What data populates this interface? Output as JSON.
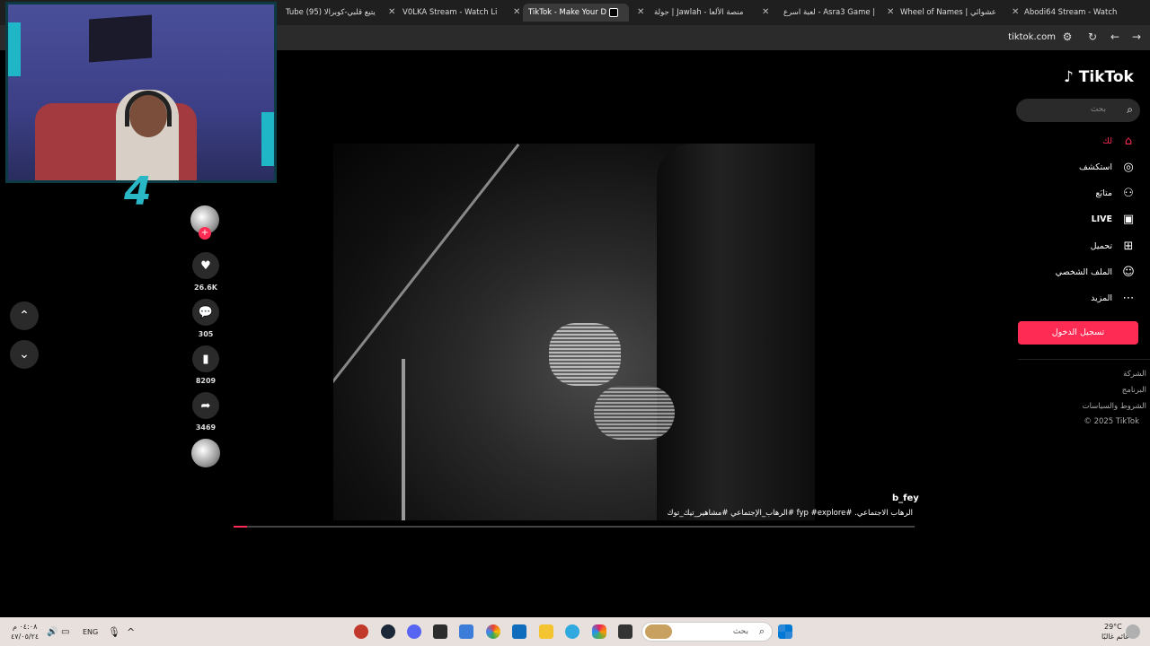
{
  "browser": {
    "tabs": [
      {
        "title": "Tube (95) يتيع قلبي-كوبرالا",
        "active": false
      },
      {
        "title": "V0LKA Stream - Watch Li",
        "active": false
      },
      {
        "title": "TikTok - Make Your D",
        "active": true
      },
      {
        "title": "جولة | Jawlah - منصة الألعا",
        "active": false
      },
      {
        "title": "لعبة اسرع - Asra3 Game |",
        "active": false
      },
      {
        "title": "Wheel of Names | عشوائي",
        "active": false
      },
      {
        "title": "Abodi64 Stream - Watch",
        "active": false
      }
    ],
    "url": "tiktok.com"
  },
  "overlay": {
    "logo": "4"
  },
  "video": {
    "author": "b_fey",
    "caption": "الرهاب الاجتماعي. #fyp #explore #الرهاب_الإجتماعي #مشاهير_تيك_توك",
    "progress": 0.02
  },
  "actions": {
    "likes": "26.6K",
    "comments": "305",
    "saves": "8209",
    "shares": "3469",
    "follow_symbol": "+"
  },
  "sidebar": {
    "brand": "TikTok",
    "search_placeholder": "بحث",
    "menu": [
      {
        "label": "لك",
        "icon": "home-icon",
        "active": true
      },
      {
        "label": "استكشف",
        "icon": "compass-icon",
        "active": false
      },
      {
        "label": "متابَع",
        "icon": "following-icon",
        "active": false
      },
      {
        "label": "LIVE",
        "icon": "live-icon",
        "active": false
      },
      {
        "label": "تحميل",
        "icon": "upload-icon",
        "active": false
      },
      {
        "label": "الملف الشخصي",
        "icon": "profile-icon",
        "active": false
      },
      {
        "label": "المزيد",
        "icon": "more-icon",
        "active": false
      }
    ],
    "login_label": "تسجيل الدخول",
    "footer": [
      "الشركة",
      "البرنامج",
      "الشروط والسياسات",
      "© 2025 TikTok"
    ]
  },
  "taskbar": {
    "time": "٠٤:٠٨ م",
    "date": "٤٧/٠٥/٢٤",
    "language": "ENG",
    "search_label": "بحث",
    "weather_temp": "29°C",
    "weather_desc": "غائم غالبًا"
  },
  "colors": {
    "accent": "#fe2c55",
    "brand_teal": "#2ab7c5"
  }
}
